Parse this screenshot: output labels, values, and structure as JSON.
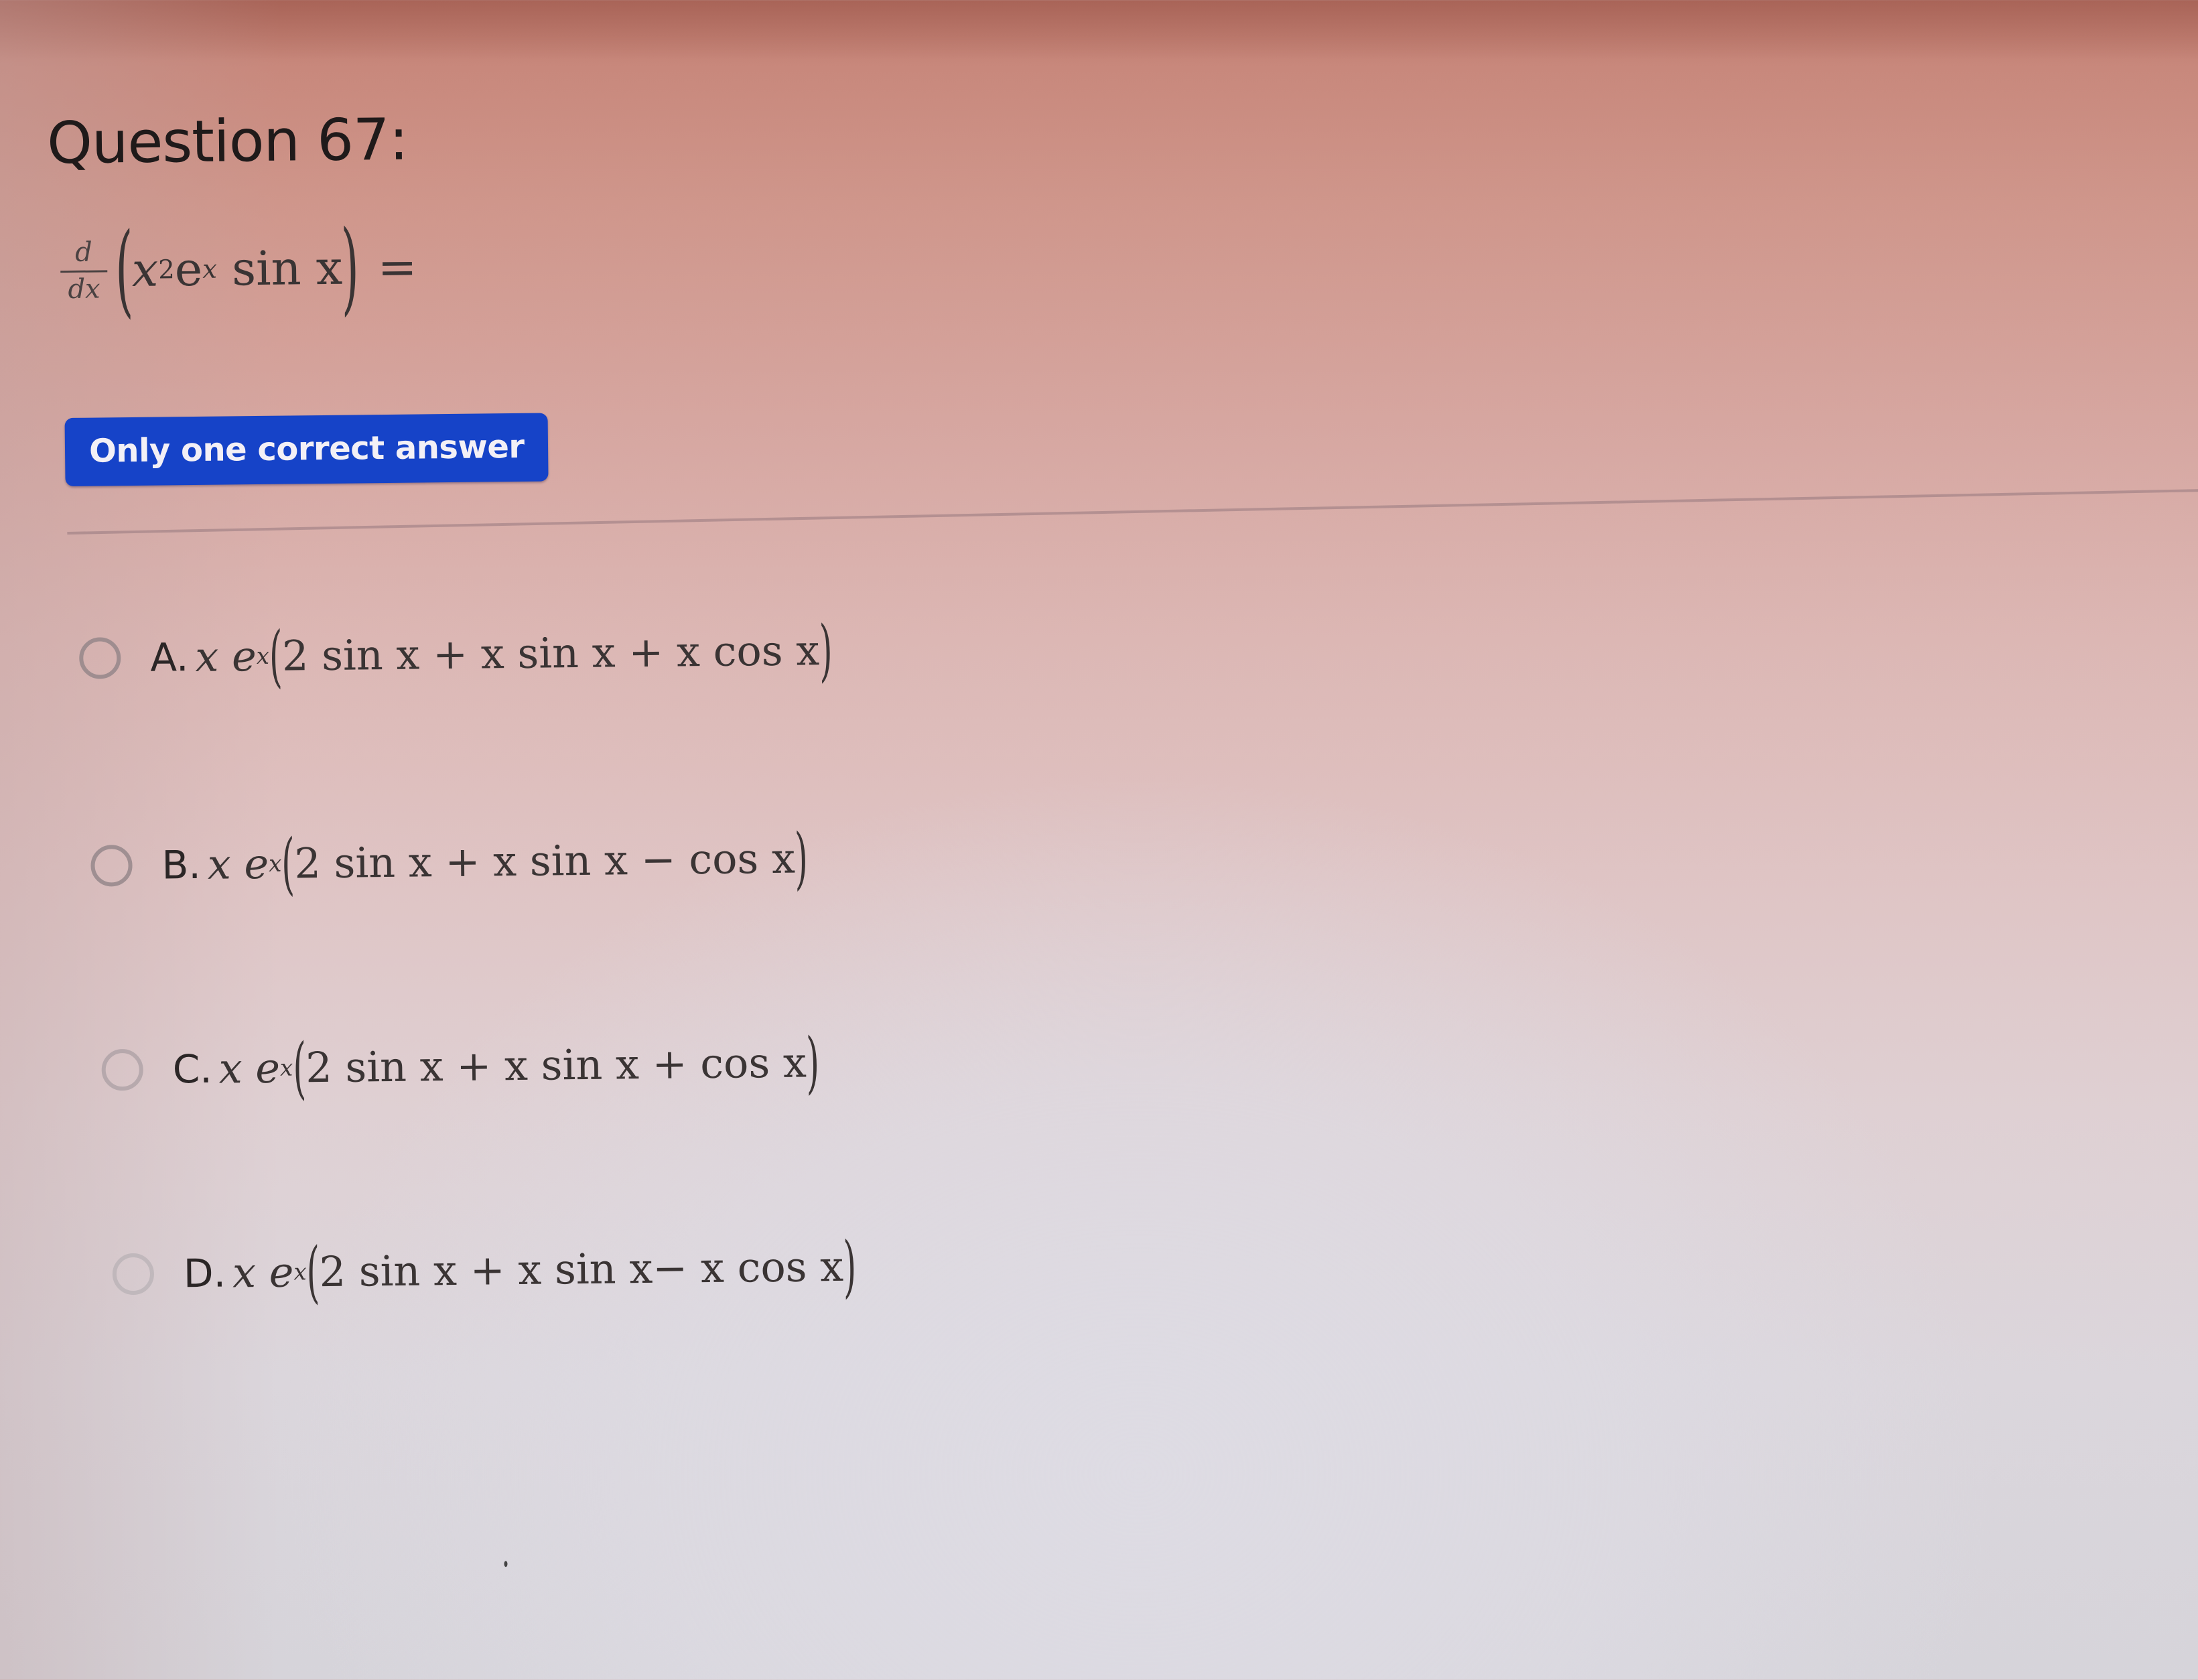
{
  "question": {
    "title": "Question 67:",
    "expression": {
      "derivative_num": "d",
      "derivative_den": "dx",
      "open_paren": "(",
      "base": "x",
      "base_exp": "2",
      "e": "e",
      "e_exp": "x",
      "func": " sin x",
      "close_paren": ")",
      "equals": "="
    }
  },
  "badge": {
    "label": "Only one correct answer",
    "color": "#1643c8"
  },
  "options": [
    {
      "letter": "A.",
      "prefix": "x e",
      "exp": "x",
      "body": "2 sin x + x sin x + x cos x",
      "selected": false
    },
    {
      "letter": "B.",
      "prefix": "x e",
      "exp": "x",
      "body": "2 sin x + x sin x − cos x",
      "selected": false
    },
    {
      "letter": "C.",
      "prefix": "x e",
      "exp": "x",
      "body": "2 sin x + x sin x + cos x",
      "selected": false
    },
    {
      "letter": "D.",
      "prefix": "x e",
      "exp": "x",
      "body": "2 sin x + x sin x− x cos x",
      "selected": false
    }
  ],
  "parens": {
    "open": "(",
    "close": ")"
  }
}
